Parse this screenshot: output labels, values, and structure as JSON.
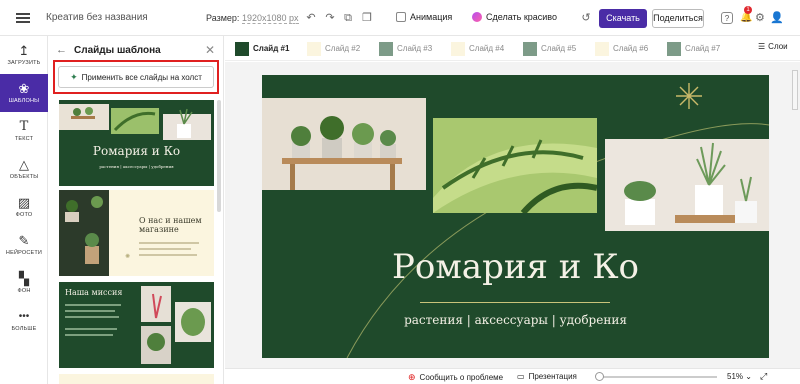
{
  "header": {
    "doc_title": "Креатив без названия",
    "size_label": "Размер:",
    "size_value": "1920x1080",
    "size_unit": "px",
    "animation_label": "Анимация",
    "make_pretty_label": "Сделать красиво",
    "download_label": "Скачать",
    "share_label": "Поделиться",
    "notifications_count": "1"
  },
  "nav": [
    {
      "id": "upload",
      "label": "ЗАГРУЗИТЬ",
      "icon": "↥"
    },
    {
      "id": "templates",
      "label": "ШАБЛОНЫ",
      "icon": "❀"
    },
    {
      "id": "text",
      "label": "ТЕКСТ",
      "icon": "T"
    },
    {
      "id": "objects",
      "label": "ОБЪЕКТЫ",
      "icon": "△"
    },
    {
      "id": "photo",
      "label": "ФОТО",
      "icon": "▨"
    },
    {
      "id": "ai",
      "label": "НЕЙРОСЕТИ",
      "icon": "✎"
    },
    {
      "id": "background",
      "label": "ФОН",
      "icon": "▚"
    },
    {
      "id": "more",
      "label": "БОЛЬШЕ",
      "icon": "•••"
    }
  ],
  "panel": {
    "title": "Слайды шаблона",
    "apply_all_label": "Применить все слайды на холст",
    "thumb1": {
      "title": "Ромария и Ко",
      "subtitle": "растения | аксессуары | удобрения"
    },
    "thumb2": {
      "title": "О нас и нашем магазине"
    },
    "thumb3": {
      "title": "Наша миссия"
    }
  },
  "slides_strip": {
    "items": [
      {
        "label": "Слайд #1",
        "color": "#1f4a2b"
      },
      {
        "label": "Слайд #2",
        "color": "#fbf5df"
      },
      {
        "label": "Слайд #3",
        "color": "#7d9b88"
      },
      {
        "label": "Слайд #4",
        "color": "#fbf5df"
      },
      {
        "label": "Слайд #5",
        "color": "#7d9b88"
      },
      {
        "label": "Слайд #6",
        "color": "#fbf5df"
      },
      {
        "label": "Слайд #7",
        "color": "#7d9b88"
      }
    ],
    "layers_label": "Слои"
  },
  "slide": {
    "title": "Ромария и Ко",
    "subtitle": "растения | аксессуары | удобрения"
  },
  "bottom": {
    "report_label": "Сообщить о проблеме",
    "present_label": "Презентация",
    "zoom": "51%"
  },
  "colors": {
    "brand": "#4a2ca6",
    "slide_bg": "#1f4a2b",
    "highlight": "#e02020"
  }
}
